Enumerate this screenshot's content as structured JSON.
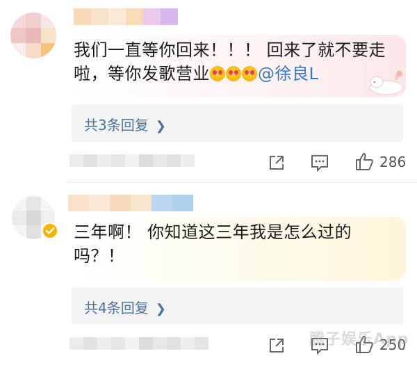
{
  "comments": [
    {
      "text_line1": "我们一直等你回来！！！ 回来了就不要走",
      "text_line2": "啦，等你发歌营业",
      "mention": "@徐良L",
      "emoji": [
        "heart-eyes-emoji",
        "heart-eyes-emoji",
        "heart-eyes-emoji"
      ],
      "reply_link": "共3条回复",
      "like_count": "286"
    },
    {
      "text_line1": "三年啊！ 你知道这三年我是怎么过的",
      "text_line2": "吗？！",
      "reply_link": "共4条回复",
      "like_count": "250"
    }
  ],
  "icons": {
    "share": "share-icon",
    "comment": "comment-icon",
    "like": "thumbs-up-icon",
    "chevron": "chevron-right-icon",
    "verified": "verified-badge-icon"
  },
  "watermark": "腾子娱乐App",
  "colors": {
    "mention": "#3a78c9",
    "reply_link": "#4d6f9c",
    "reply_box": "#f4f4f4",
    "verified": "#f5b400"
  }
}
